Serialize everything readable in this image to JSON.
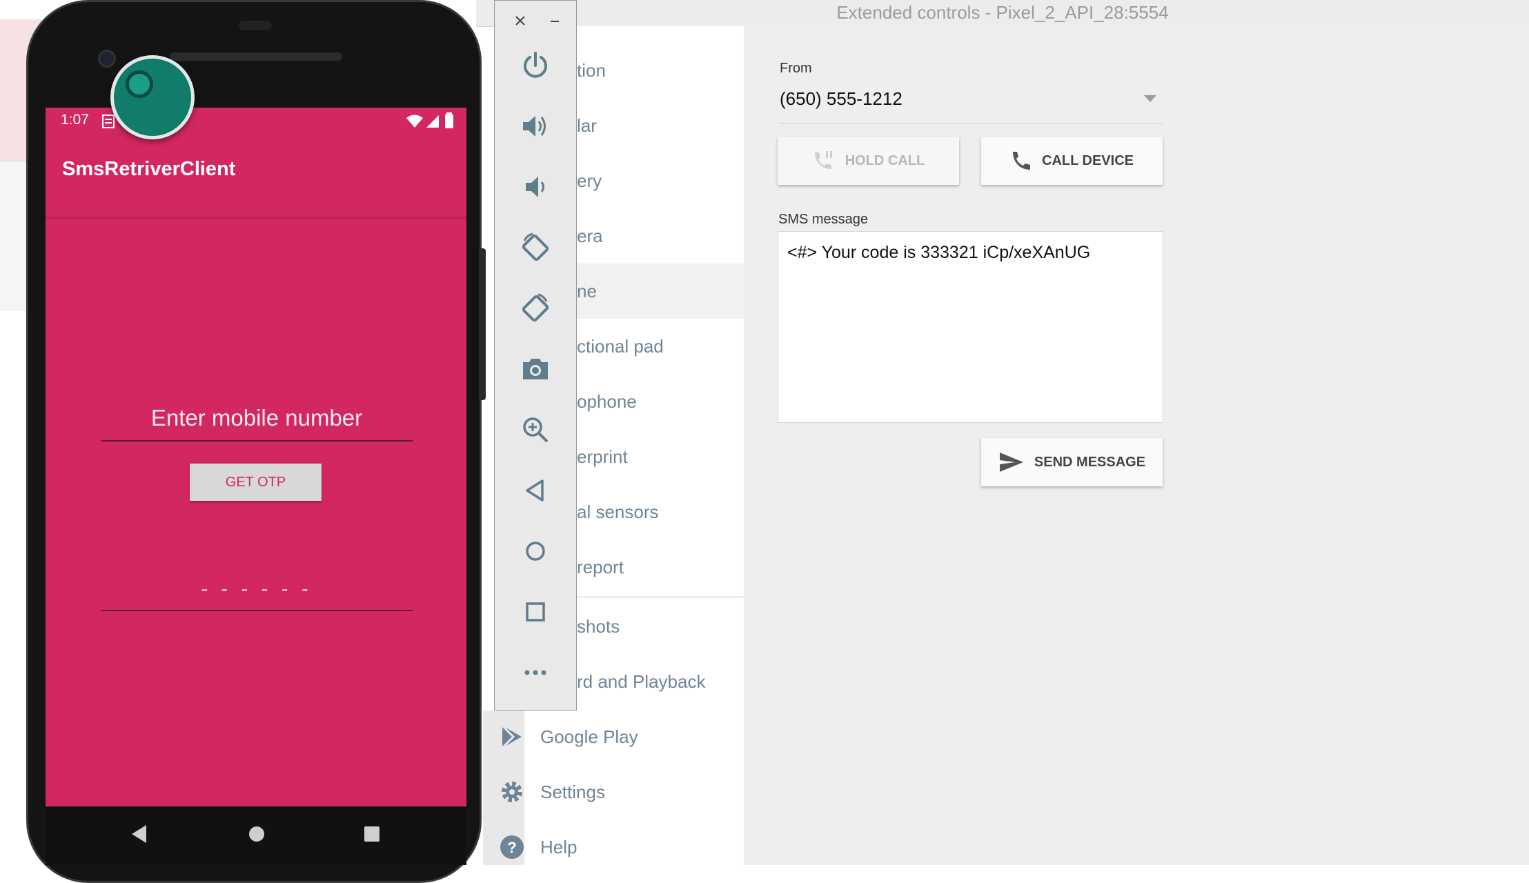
{
  "window": {
    "title": "Extended controls - Pixel_2_API_28:5554"
  },
  "device": {
    "status_time": "1:07",
    "app_title": "SmsRetriverClient",
    "mobile_placeholder": "Enter mobile number",
    "otp_button": "GET OTP",
    "otp_placeholder": "- - - - - -"
  },
  "toolbar": {
    "buttons": [
      "power-icon",
      "volume-up-icon",
      "volume-down-icon",
      "rotate-left-icon",
      "rotate-right-icon",
      "camera-icon",
      "zoom-icon",
      "back-icon",
      "home-icon",
      "overview-icon",
      "more-icon"
    ]
  },
  "nav": {
    "items": [
      "tion",
      "lar",
      "ery",
      "era",
      "ne",
      "ctional pad",
      "ophone",
      "erprint",
      "al sensors",
      "report",
      "shots",
      "rd and Playback",
      "Google Play",
      "Settings",
      "Help"
    ]
  },
  "phone_panel": {
    "from_label": "From",
    "from_value": "(650) 555-1212",
    "hold_call": "HOLD CALL",
    "call_device": "CALL DEVICE",
    "sms_label": "SMS message",
    "sms_value": "<#> Your code is 333321 iCp/xeXAnUG",
    "send_message": "SEND MESSAGE"
  },
  "colors": {
    "accent": "#d22762",
    "nav_text": "#6e8597",
    "panel_bg": "#eeeeee"
  }
}
